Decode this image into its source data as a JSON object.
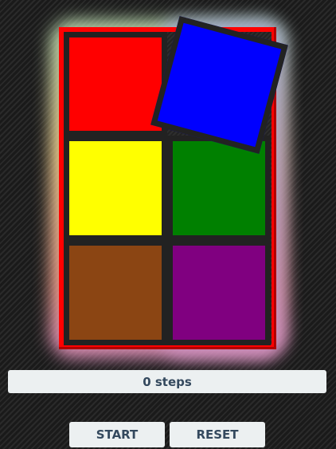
{
  "status": {
    "steps_label": "0 steps"
  },
  "buttons": {
    "start": "START",
    "reset": "RESET"
  },
  "tiles": [
    {
      "name": "red",
      "color": "#ff0000"
    },
    {
      "name": "blue",
      "color": "#0000ff"
    },
    {
      "name": "yellow",
      "color": "#ffff00"
    },
    {
      "name": "green",
      "color": "#008000"
    },
    {
      "name": "brown",
      "color": "#8b4513"
    },
    {
      "name": "purple",
      "color": "#800080"
    }
  ]
}
